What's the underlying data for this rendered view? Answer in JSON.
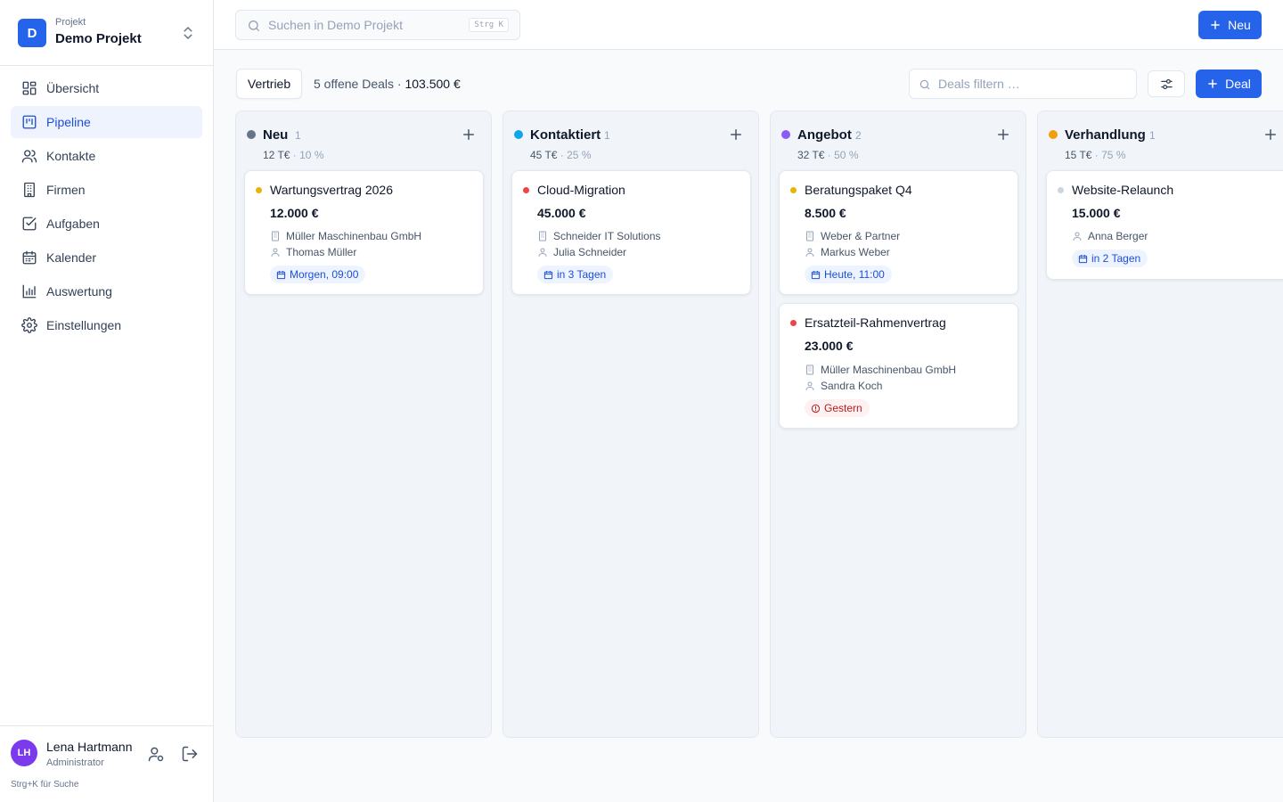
{
  "project": {
    "label": "Projekt",
    "name": "Demo Projekt",
    "initial": "D"
  },
  "nav": [
    {
      "label": "Übersicht",
      "icon": "dashboard-icon"
    },
    {
      "label": "Pipeline",
      "icon": "kanban-icon",
      "active": true
    },
    {
      "label": "Kontakte",
      "icon": "users-icon"
    },
    {
      "label": "Firmen",
      "icon": "building-icon"
    },
    {
      "label": "Aufgaben",
      "icon": "checkbox-icon"
    },
    {
      "label": "Kalender",
      "icon": "calendar-icon"
    },
    {
      "label": "Auswertung",
      "icon": "bar-chart-icon"
    },
    {
      "label": "Einstellungen",
      "icon": "gear-icon"
    }
  ],
  "user": {
    "initials": "LH",
    "name": "Lena Hartmann",
    "role": "Administrator",
    "hint": "Strg+K für Suche"
  },
  "topbar": {
    "search_placeholder": "Suchen in Demo Projekt",
    "shortcut": "Strg K",
    "new_label": "Neu"
  },
  "toolbar": {
    "view_label": "Vertrieb",
    "summary_count": "5 offene Deals",
    "summary_sep": " · ",
    "summary_total": "103.500 €",
    "filter_placeholder": "Deals filtern …",
    "deal_label": "Deal"
  },
  "colors": {
    "accent": "#2563eb",
    "neu": "#64748b",
    "kontaktiert": "#0ea5e9",
    "angebot": "#8b5cf6",
    "verhandlung": "#f59e0b"
  },
  "columns": [
    {
      "title": "Neu",
      "count": "1",
      "value": "12 T€",
      "pct": " · 10 %",
      "cards": [
        {
          "title": "Wartungsvertrag 2026",
          "amount": "12.000 €",
          "company": "Müller Maschinenbau GmbH",
          "contact": "Thomas Müller",
          "due": "Morgen, 09:00",
          "due_type": "blue",
          "priority": "#eab308"
        }
      ]
    },
    {
      "title": "Kontaktiert",
      "count": "1",
      "value": "45 T€",
      "pct": " · 25 %",
      "cards": [
        {
          "title": "Cloud-Migration",
          "amount": "45.000 €",
          "company": "Schneider IT Solutions",
          "contact": "Julia Schneider",
          "due": "in 3 Tagen",
          "due_type": "blue",
          "priority": "#ef4444"
        }
      ]
    },
    {
      "title": "Angebot",
      "count": "2",
      "value": "32 T€",
      "pct": " · 50 %",
      "cards": [
        {
          "title": "Beratungspaket Q4",
          "amount": "8.500 €",
          "company": "Weber & Partner",
          "contact": "Markus Weber",
          "due": "Heute, 11:00",
          "due_type": "blue",
          "priority": "#eab308"
        },
        {
          "title": "Ersatzteil-Rahmenvertrag",
          "amount": "23.000 €",
          "company": "Müller Maschinenbau GmbH",
          "contact": "Sandra Koch",
          "due": "Gestern",
          "due_type": "red",
          "priority": "#ef4444"
        }
      ]
    },
    {
      "title": "Verhandlung",
      "count": "1",
      "value": "15 T€",
      "pct": " · 75 %",
      "cards": [
        {
          "title": "Website-Relaunch",
          "amount": "15.000 €",
          "company": "",
          "contact": "Anna Berger",
          "due": "in 2 Tagen",
          "due_type": "blue",
          "priority": "#cbd5e1"
        }
      ]
    }
  ]
}
